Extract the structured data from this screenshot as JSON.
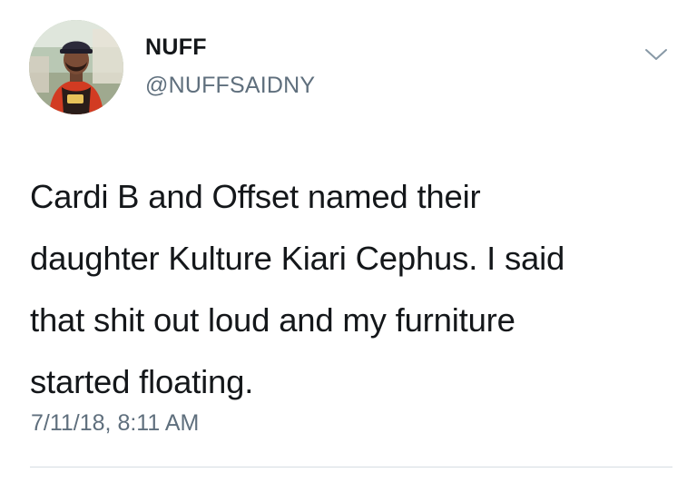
{
  "tweet": {
    "author": {
      "display_name": "NUFF",
      "handle": "@NUFFSAIDNY",
      "avatar_icon": "profile-photo"
    },
    "menu_icon": "chevron-down-icon",
    "text_lines": [
      "Cardi B and Offset named their",
      "daughter Kulture Kiari Cephus. I said",
      "that shit out loud and my furniture",
      "started floating."
    ],
    "timestamp": "7/11/18, 8:11 AM"
  },
  "colors": {
    "text_primary": "#14171a",
    "text_secondary": "#5f6f7d",
    "divider": "#d6dde3",
    "background": "#ffffff"
  }
}
